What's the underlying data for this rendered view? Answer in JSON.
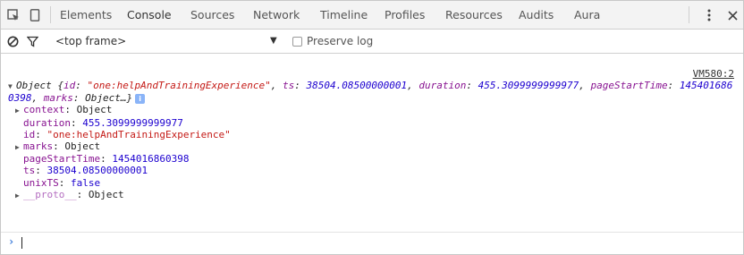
{
  "tabs": [
    {
      "label": "Elements"
    },
    {
      "label": "Console",
      "active": true
    },
    {
      "label": "Sources"
    },
    {
      "label": "Network"
    },
    {
      "label": "Timeline"
    },
    {
      "label": "Profiles"
    },
    {
      "label": "Resources"
    },
    {
      "label": "Audits"
    },
    {
      "label": "Aura"
    }
  ],
  "toolbar": {
    "frame_selector": "<top frame>",
    "preserve_log_label": "Preserve log"
  },
  "icons": {
    "inspect": "inspect-element-icon",
    "device": "device-mode-icon",
    "menu": "more-vert-icon",
    "close": "close-icon",
    "clear": "clear-console-icon",
    "filter": "filter-icon",
    "dropdown": "dropdown-arrow-icon"
  },
  "console": {
    "source_link": "VM580:2",
    "summary": {
      "prefix": "Object {",
      "id_key": "id",
      "id_val": "\"one:helpAndTrainingExperience\"",
      "ts_key": "ts",
      "ts_val": "38504.08500000001",
      "duration_key": "duration",
      "duration_val": "455.3099999999977",
      "pst_key": "pageStartTime",
      "pst_val": "1454016860398",
      "marks_key": "marks",
      "marks_val": "Object",
      "suffix": "…}",
      "info_badge": "i"
    },
    "props": [
      {
        "key": "context",
        "value": "Object",
        "type": "object",
        "expandable": true
      },
      {
        "key": "duration",
        "value": "455.3099999999977",
        "type": "num",
        "expandable": false
      },
      {
        "key": "id",
        "value": "\"one:helpAndTrainingExperience\"",
        "type": "str",
        "expandable": false
      },
      {
        "key": "marks",
        "value": "Object",
        "type": "object",
        "expandable": true
      },
      {
        "key": "pageStartTime",
        "value": "1454016860398",
        "type": "num",
        "expandable": false
      },
      {
        "key": "ts",
        "value": "38504.08500000001",
        "type": "num",
        "expandable": false
      },
      {
        "key": "unixTS",
        "value": "false",
        "type": "num",
        "expandable": false
      },
      {
        "key": "__proto__",
        "value": "Object",
        "type": "object",
        "expandable": true,
        "proto": true
      }
    ]
  },
  "prompt": {
    "chevron": "›",
    "value": ""
  },
  "colors": {
    "key": "#881391",
    "string": "#c41a16",
    "number": "#1c00cf",
    "prompt": "#3879d9"
  }
}
